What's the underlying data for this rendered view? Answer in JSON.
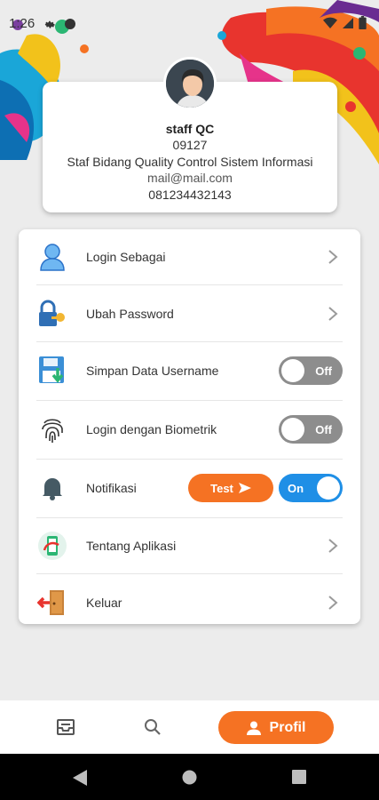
{
  "status_bar": {
    "time": "1:26",
    "icons": [
      "gear-icon",
      "dot-icon",
      "wifi-icon",
      "signal-icon",
      "battery-icon"
    ]
  },
  "profile": {
    "name": "staff QC",
    "id": "09127",
    "position": "Staf Bidang Quality Control Sistem Informasi",
    "email": "mail@mail.com",
    "phone": "081234432143"
  },
  "menu": {
    "login_as": "Login Sebagai",
    "change_password": "Ubah Password",
    "save_username": "Simpan Data Username",
    "save_username_state": "Off",
    "biometric_login": "Login dengan Biometrik",
    "biometric_state": "Off",
    "notification": "Notifikasi",
    "notification_test": "Test",
    "notification_state": "On",
    "about_app": "Tentang Aplikasi",
    "logout": "Keluar"
  },
  "bottom_nav": {
    "active_label": "Profil",
    "items": [
      "inbox-icon",
      "search-icon",
      "person-icon"
    ]
  },
  "colors": {
    "accent": "#f57223",
    "toggle_on": "#1f8fe6",
    "toggle_off": "#8d8d8d"
  }
}
